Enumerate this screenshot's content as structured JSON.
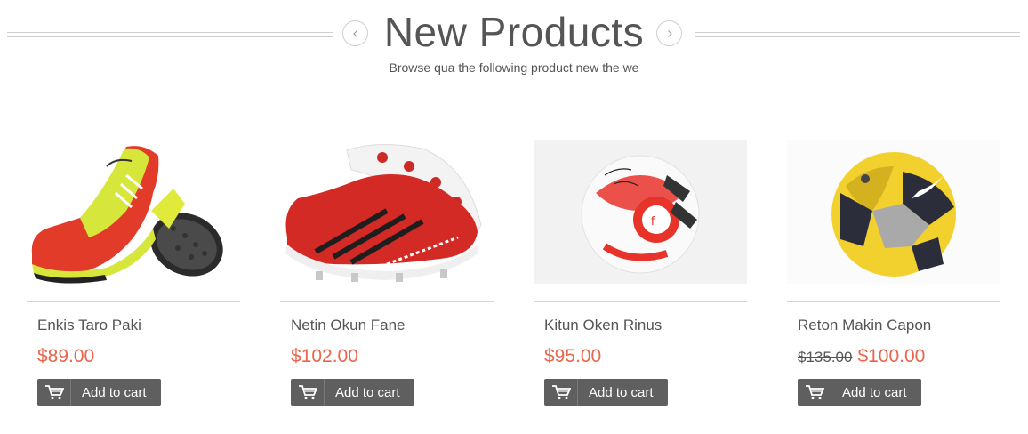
{
  "header": {
    "title": "New Products",
    "subtitle": "Browse qua the following product new the we"
  },
  "products": [
    {
      "name": "Enkis Taro Paki",
      "price": "$89.00",
      "old_price": "",
      "cart_label": "Add to cart",
      "image_icon": "soccer-cleats-red-yellow"
    },
    {
      "name": "Netin Okun Fane",
      "price": "$102.00",
      "old_price": "",
      "cart_label": "Add to cart",
      "image_icon": "soccer-cleat-red"
    },
    {
      "name": "Kitun Oken Rinus",
      "price": "$95.00",
      "old_price": "",
      "cart_label": "Add to cart",
      "image_icon": "soccer-ball-white-red"
    },
    {
      "name": "Reton Makin Capon",
      "price": "$100.00",
      "old_price": "$135.00",
      "cart_label": "Add to cart",
      "image_icon": "soccer-ball-yellow"
    }
  ],
  "colors": {
    "accent": "#e8664c",
    "button": "#5f5f5f",
    "text": "#555555"
  }
}
